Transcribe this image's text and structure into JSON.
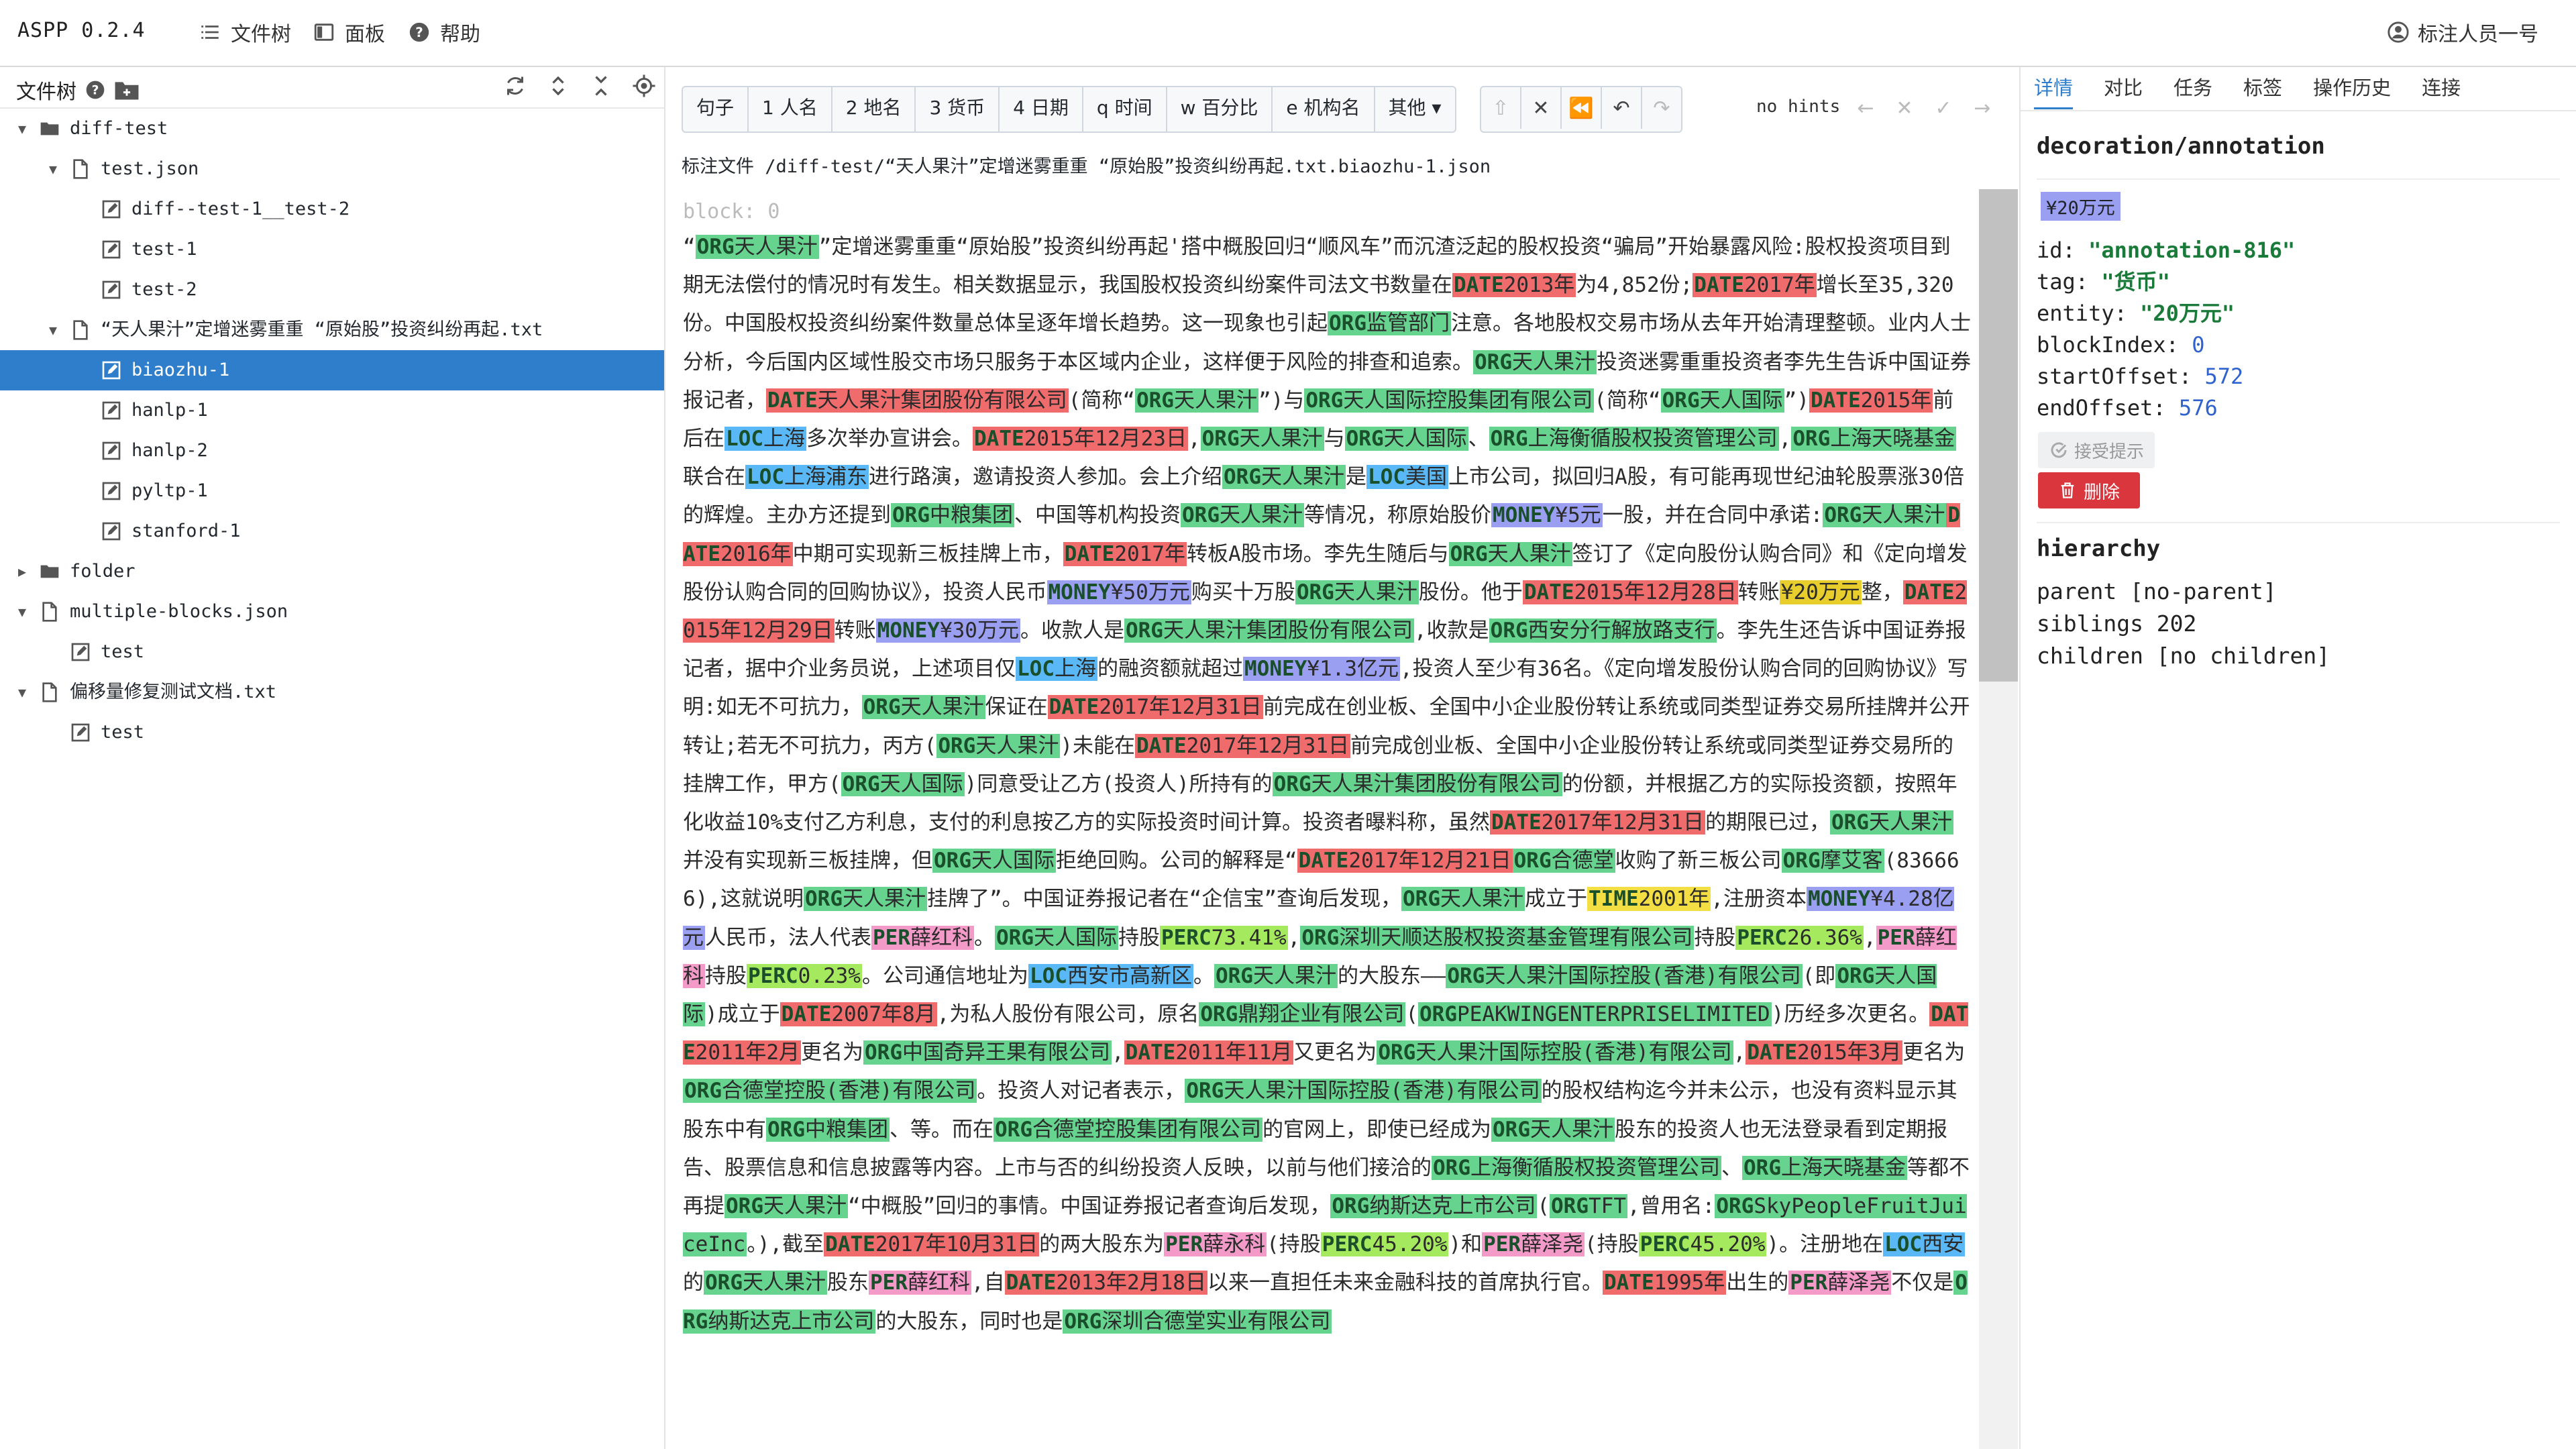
{
  "app": {
    "title": "ASPP 0.2.4"
  },
  "menu": {
    "file_tree": "文件树",
    "panel": "面板",
    "help": "帮助",
    "user": "标注人员一号"
  },
  "sidebar": {
    "title": "文件树",
    "tree": [
      {
        "label": "diff-test",
        "type": "folder",
        "level": 0,
        "expanded": true
      },
      {
        "label": "test.json",
        "type": "file",
        "level": 1,
        "expanded": true
      },
      {
        "label": "diff--test-1__test-2",
        "type": "annotation",
        "level": 2
      },
      {
        "label": "test-1",
        "type": "annotation",
        "level": 2
      },
      {
        "label": "test-2",
        "type": "annotation",
        "level": 2
      },
      {
        "label": "“天人果汁”定增迷雾重重 “原始股”投资纠纷再起.txt",
        "type": "file",
        "level": 1,
        "expanded": true
      },
      {
        "label": "biaozhu-1",
        "type": "annotation",
        "level": 2,
        "selected": true
      },
      {
        "label": "hanlp-1",
        "type": "annotation",
        "level": 2
      },
      {
        "label": "hanlp-2",
        "type": "annotation",
        "level": 2
      },
      {
        "label": "pyltp-1",
        "type": "annotation",
        "level": 2
      },
      {
        "label": "stanford-1",
        "type": "annotation",
        "level": 2
      },
      {
        "label": "folder",
        "type": "folder",
        "level": 0,
        "expanded": false
      },
      {
        "label": "multiple-blocks.json",
        "type": "file",
        "level": 0,
        "expanded": true
      },
      {
        "label": "test",
        "type": "annotation",
        "level": 1
      },
      {
        "label": "偏移量修复测试文档.txt",
        "type": "file",
        "level": 0,
        "expanded": true
      },
      {
        "label": "test",
        "type": "annotation",
        "level": 1
      }
    ]
  },
  "toolbar": {
    "tags": [
      "句子",
      "1 人名",
      "2 地名",
      "3 货币",
      "4 日期",
      "q 时间",
      "w 百分比",
      "e 机构名",
      "其他 ▾"
    ],
    "hints": "no hints"
  },
  "file_path": "标注文件 /diff-test/“天人果汁”定增迷雾重重 “原始股”投资纠纷再起.txt.biaozhu-1.json",
  "block_label": "block: 0",
  "document": {
    "segments": [
      [
        "",
        "“"
      ],
      [
        "ORG",
        "天人果汁"
      ],
      [
        "",
        "”定增迷雾重重“原始股”投资纠纷再起'搭中概股回归“顺风车”而沉渣泛起的股权投资“骗局”开始暴露风险:股权投资项目到期无法偿付的情况时有发生。相关数据显示，我国股权投资纠纷案件司法文书数量在"
      ],
      [
        "DATE",
        "2013年"
      ],
      [
        "",
        "为4,852份;"
      ],
      [
        "DATE",
        "2017年"
      ],
      [
        "",
        "增长至35,320份。中国股权投资纠纷案件数量总体呈逐年增长趋势。这一现象也引起"
      ],
      [
        "ORG",
        "监管部门"
      ],
      [
        "",
        "注意。各地股权交易市场从去年开始清理整顿。业内人士分析，今后国内区域性股交市场只服务于本区域内企业，这样便于风险的排查和追索。"
      ],
      [
        "ORG",
        "天人果汁"
      ],
      [
        "",
        "投资迷雾重重投资者李先生告诉中国证券报记者，"
      ],
      [
        "DATE",
        "天人果汁集团股份有限公司"
      ],
      [
        "",
        "(简称“"
      ],
      [
        "ORG",
        "天人果汁"
      ],
      [
        "",
        "”)与"
      ],
      [
        "ORG",
        "天人国际控股集团有限公司"
      ],
      [
        "",
        "(简称“"
      ],
      [
        "ORG",
        "天人国际"
      ],
      [
        "",
        "”)"
      ],
      [
        "DATE",
        "2015年"
      ],
      [
        "",
        "前后在"
      ],
      [
        "LOC",
        "上海"
      ],
      [
        "",
        "多次举办宣讲会。"
      ],
      [
        "DATE",
        "2015年12月23日"
      ],
      [
        "",
        ","
      ],
      [
        "ORG",
        "天人果汁"
      ],
      [
        "",
        "与"
      ],
      [
        "ORG",
        "天人国际"
      ],
      [
        "",
        "、"
      ],
      [
        "ORG",
        "上海衡循股权投资管理公司"
      ],
      [
        "",
        ","
      ],
      [
        "ORG",
        "上海天晓基金"
      ],
      [
        "",
        "联合在"
      ],
      [
        "LOC",
        "上海浦东"
      ],
      [
        "",
        "进行路演，邀请投资人参加。会上介绍"
      ],
      [
        "ORG",
        "天人果汁"
      ],
      [
        "",
        "是"
      ],
      [
        "LOC",
        "美国"
      ],
      [
        "",
        "上市公司，拟回归A股，有可能再现世纪油轮股票涨30倍的辉煌。主办方还提到"
      ],
      [
        "ORG",
        "中粮集团"
      ],
      [
        "",
        "、中国等机构投资"
      ],
      [
        "ORG",
        "天人果汁"
      ],
      [
        "",
        "等情况，称原始股价"
      ],
      [
        "MONEY",
        "¥5元"
      ],
      [
        "",
        "一股，并在合同中承诺:"
      ],
      [
        "ORG",
        "天人果汁"
      ],
      [
        "DATE",
        "2016年"
      ],
      [
        "",
        "中期可实现新三板挂牌上市，"
      ],
      [
        "DATE",
        "2017年"
      ],
      [
        "",
        "转板A股市场。李先生随后与"
      ],
      [
        "ORG",
        "天人果汁"
      ],
      [
        "",
        "签订了《定向股份认购合同》和《定向增发股份认购合同的回购协议》，投资人民币"
      ],
      [
        "MONEY",
        "¥50万元"
      ],
      [
        "",
        "购买十万股"
      ],
      [
        "ORG",
        "天人果汁"
      ],
      [
        "",
        "股份。他于"
      ],
      [
        "DATE",
        "2015年12月28日"
      ],
      [
        "",
        "转账"
      ],
      [
        "MONEY_SEL",
        "¥20万元"
      ],
      [
        "",
        "整，"
      ],
      [
        "DATE",
        "2015年12月29日"
      ],
      [
        "",
        "转账"
      ],
      [
        "MONEY",
        "¥30万元"
      ],
      [
        "",
        "。收款人是"
      ],
      [
        "ORG",
        "天人果汁集团股份有限公司"
      ],
      [
        "",
        ",收款是"
      ],
      [
        "ORG",
        "西安分行解放路支行"
      ],
      [
        "",
        "。李先生还告诉中国证券报记者，据中介业务员说，上述项目仅"
      ],
      [
        "LOC",
        "上海"
      ],
      [
        "",
        "的融资额就超过"
      ],
      [
        "MONEY",
        "¥1.3亿元"
      ],
      [
        "",
        ",投资人至少有36名。《定向增发股份认购合同的回购协议》写明:如无不可抗力，"
      ],
      [
        "ORG",
        "天人果汁"
      ],
      [
        "",
        "保证在"
      ],
      [
        "DATE",
        "2017年12月31日"
      ],
      [
        "",
        "前完成在创业板、全国中小企业股份转让系统或同类型证券交易所挂牌并公开转让;若无不可抗力，丙方("
      ],
      [
        "ORG",
        "天人果汁"
      ],
      [
        "",
        ")未能在"
      ],
      [
        "DATE",
        "2017年12月31日"
      ],
      [
        "",
        "前完成创业板、全国中小企业股份转让系统或同类型证券交易所的挂牌工作，甲方("
      ],
      [
        "ORG",
        "天人国际"
      ],
      [
        "",
        ")同意受让乙方(投资人)所持有的"
      ],
      [
        "ORG",
        "天人果汁集团股份有限公司"
      ],
      [
        "",
        "的份额，并根据乙方的实际投资额，按照年化收益10%支付乙方利息，支付的利息按乙方的实际投资时间计算。投资者曝料称，虽然"
      ],
      [
        "DATE",
        "2017年12月31日"
      ],
      [
        "",
        "的期限已过，"
      ],
      [
        "ORG",
        "天人果汁"
      ],
      [
        "",
        "并没有实现新三板挂牌，但"
      ],
      [
        "ORG",
        "天人国际"
      ],
      [
        "",
        "拒绝回购。公司的解释是“"
      ],
      [
        "DATE",
        "2017年12月21日"
      ],
      [
        "ORG",
        "合德堂"
      ],
      [
        "",
        "收购了新三板公司"
      ],
      [
        "ORG",
        "摩艾客"
      ],
      [
        "",
        "(836666),这就说明"
      ],
      [
        "ORG",
        "天人果汁"
      ],
      [
        "",
        "挂牌了”。中国证券报记者在“企信宝”查询后发现，"
      ],
      [
        "ORG",
        "天人果汁"
      ],
      [
        "",
        "成立于"
      ],
      [
        "TIME",
        "2001年"
      ],
      [
        "",
        ",注册资本"
      ],
      [
        "MONEY",
        "¥4.28亿元"
      ],
      [
        "",
        "人民币，法人代表"
      ],
      [
        "PER",
        "薛红科"
      ],
      [
        "",
        "。"
      ],
      [
        "ORG",
        "天人国际"
      ],
      [
        "",
        "持股"
      ],
      [
        "PERC",
        "73.41%"
      ],
      [
        "",
        ","
      ],
      [
        "ORG",
        "深圳天顺达股权投资基金管理有限公司"
      ],
      [
        "",
        "持股"
      ],
      [
        "PERC",
        "26.36%"
      ],
      [
        "",
        ","
      ],
      [
        "PER",
        "薛红科"
      ],
      [
        "",
        "持股"
      ],
      [
        "PERC",
        "0.23%"
      ],
      [
        "",
        "。公司通信地址为"
      ],
      [
        "LOC",
        "西安市高新区"
      ],
      [
        "",
        "。"
      ],
      [
        "ORG",
        "天人果汁"
      ],
      [
        "",
        "的大股东——"
      ],
      [
        "ORG",
        "天人果汁国际控股(香港)有限公司"
      ],
      [
        "",
        "(即"
      ],
      [
        "ORG",
        "天人国际"
      ],
      [
        "",
        ")成立于"
      ],
      [
        "DATE",
        "2007年8月"
      ],
      [
        "",
        ",为私人股份有限公司，原名"
      ],
      [
        "ORG",
        "鼎翔企业有限公司"
      ],
      [
        "",
        "("
      ],
      [
        "ORG",
        "PEAKWINGENTERPRISELIMITED"
      ],
      [
        "",
        ")历经多次更名。"
      ],
      [
        "DATE",
        "2011年2月"
      ],
      [
        "",
        "更名为"
      ],
      [
        "ORG",
        "中国奇异王果有限公司"
      ],
      [
        "",
        ","
      ],
      [
        "DATE",
        "2011年11月"
      ],
      [
        "",
        "又更名为"
      ],
      [
        "ORG",
        "天人果汁国际控股(香港)有限公司"
      ],
      [
        "",
        ","
      ],
      [
        "DATE",
        "2015年3月"
      ],
      [
        "",
        "更名为"
      ],
      [
        "ORG",
        "合德堂控股(香港)有限公司"
      ],
      [
        "",
        "。投资人对记者表示，"
      ],
      [
        "ORG",
        "天人果汁国际控股(香港)有限公司"
      ],
      [
        "",
        "的股权结构迄今并未公示，也没有资料显示其股东中有"
      ],
      [
        "ORG",
        "中粮集团"
      ],
      [
        "",
        "、等。而在"
      ],
      [
        "ORG",
        "合德堂控股集团有限公司"
      ],
      [
        "",
        "的官网上，即使已经成为"
      ],
      [
        "ORG",
        "天人果汁"
      ],
      [
        "",
        "股东的投资人也无法登录看到定期报告、股票信息和信息披露等内容。上市与否的纠纷投资人反映，以前与他们接洽的"
      ],
      [
        "ORG",
        "上海衡循股权投资管理公司"
      ],
      [
        "",
        "、"
      ],
      [
        "ORG",
        "上海天晓基金"
      ],
      [
        "",
        "等都不再提"
      ],
      [
        "ORG",
        "天人果汁"
      ],
      [
        "",
        "“中概股”回归的事情。中国证券报记者查询后发现，"
      ],
      [
        "ORG",
        "纳斯达克上市公司"
      ],
      [
        "",
        "("
      ],
      [
        "ORG",
        "TFT"
      ],
      [
        "",
        ",曾用名:"
      ],
      [
        "ORG",
        "SkyPeopleFruitJuiceInc"
      ],
      [
        "",
        "。),截至"
      ],
      [
        "DATE",
        "2017年10月31日"
      ],
      [
        "",
        "的两大股东为"
      ],
      [
        "PER",
        "薛永科"
      ],
      [
        "",
        "(持股"
      ],
      [
        "PERC",
        "45.20%"
      ],
      [
        "",
        ")和"
      ],
      [
        "PER",
        "薛泽尧"
      ],
      [
        "",
        "(持股"
      ],
      [
        "PERC",
        "45.20%"
      ],
      [
        "",
        ")。注册地在"
      ],
      [
        "LOC",
        "西安"
      ],
      [
        "",
        "的"
      ],
      [
        "ORG",
        "天人果汁"
      ],
      [
        "",
        "股东"
      ],
      [
        "PER",
        "薛红科"
      ],
      [
        "",
        ",自"
      ],
      [
        "DATE",
        "2013年2月18日"
      ],
      [
        "",
        "以来一直担任未来金融科技的首席执行官。"
      ],
      [
        "DATE",
        "1995年"
      ],
      [
        "",
        "出生的"
      ],
      [
        "PER",
        "薛泽尧"
      ],
      [
        "",
        "不仅是"
      ],
      [
        "ORG",
        "纳斯达克上市公司"
      ],
      [
        "",
        "的大股东，同时也是"
      ],
      [
        "ORG",
        "深圳合德堂实业有限公司"
      ]
    ]
  },
  "right_panel": {
    "tabs": [
      "详情",
      "对比",
      "任务",
      "标签",
      "操作历史",
      "连接"
    ],
    "section_title": "decoration/annotation",
    "selected_text": "¥20万元",
    "props": {
      "id_key": "id:",
      "id_val": "\"annotation-816\"",
      "tag_key": "tag:",
      "tag_val": "\"货币\"",
      "entity_key": "entity:",
      "entity_val": "\"20万元\"",
      "blockIndex_key": "blockIndex:",
      "blockIndex_val": "0",
      "startOffset_key": "startOffset:",
      "startOffset_val": "572",
      "endOffset_key": "endOffset:",
      "endOffset_val": "576"
    },
    "accept_label": "接受提示",
    "delete_label": "删除",
    "hierarchy_title": "hierarchy",
    "hierarchy": {
      "parent": "parent [no-parent]",
      "siblings": "siblings 202",
      "children": "children [no children]"
    }
  },
  "colors": {
    "ORG": "#66d38f",
    "DATE": "#f06b6b",
    "LOC": "#59b8f5",
    "MONEY": "#9a9ff2",
    "MONEY_SEL": "#e8ce2c",
    "PER": "#f49ac9",
    "PERC": "#a5ea5e",
    "TIME": "#f3df43",
    "accent": "#2f7ecb",
    "delete": "#d9363e"
  }
}
